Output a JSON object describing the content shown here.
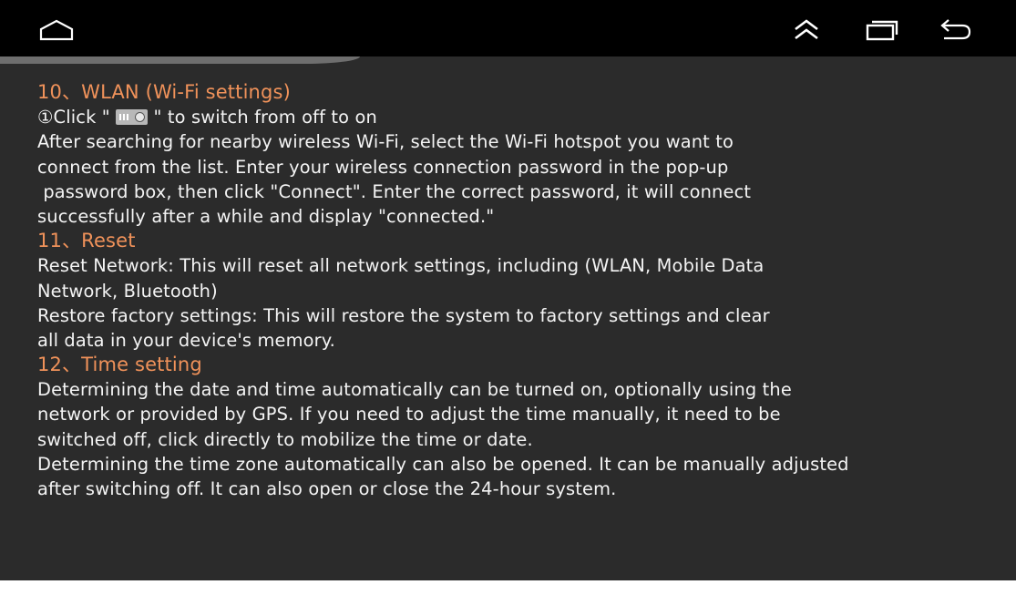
{
  "nav_bar": {
    "home_icon": "home-outline-icon",
    "up_icon": "double-chevron-up-icon",
    "recents_icon": "recent-apps-icon",
    "back_icon": "back-arrow-icon"
  },
  "colors": {
    "background": "#2b2b2b",
    "status_bar": "#000000",
    "heading": "#f0925a",
    "body_text": "#f4f4f4"
  },
  "sections": {
    "wlan": {
      "heading": "10、WLAN (Wi-Fi settings)",
      "step_prefix": "①Click \" ",
      "step_icon": "toggle-switch-icon",
      "step_suffix": " \" to switch from off to on",
      "lines": [
        "After searching for nearby wireless Wi-Fi, select the Wi-Fi hotspot you want to",
        "connect from the list. Enter your wireless connection password in the pop-up",
        " password box, then click \"Connect\". Enter the correct password, it will connect",
        "successfully after a while and display \"connected.\""
      ]
    },
    "reset": {
      "heading": "11、Reset",
      "lines": [
        "Reset Network: This will reset all network settings, including (WLAN, Mobile Data",
        "Network, Bluetooth)",
        "Restore factory settings: This will restore the system to factory settings and clear",
        "all data in your device's memory."
      ]
    },
    "time": {
      "heading": "12、Time setting",
      "lines": [
        "Determining the date and time automatically can be turned on, optionally using the",
        "network or provided by GPS. If you need to adjust the time manually, it need to be",
        "switched off, click directly to mobilize the time or date.",
        "Determining the time zone automatically can also be opened. It can be manually adjusted",
        "after switching off. It can also open or close the 24-hour system."
      ]
    }
  }
}
